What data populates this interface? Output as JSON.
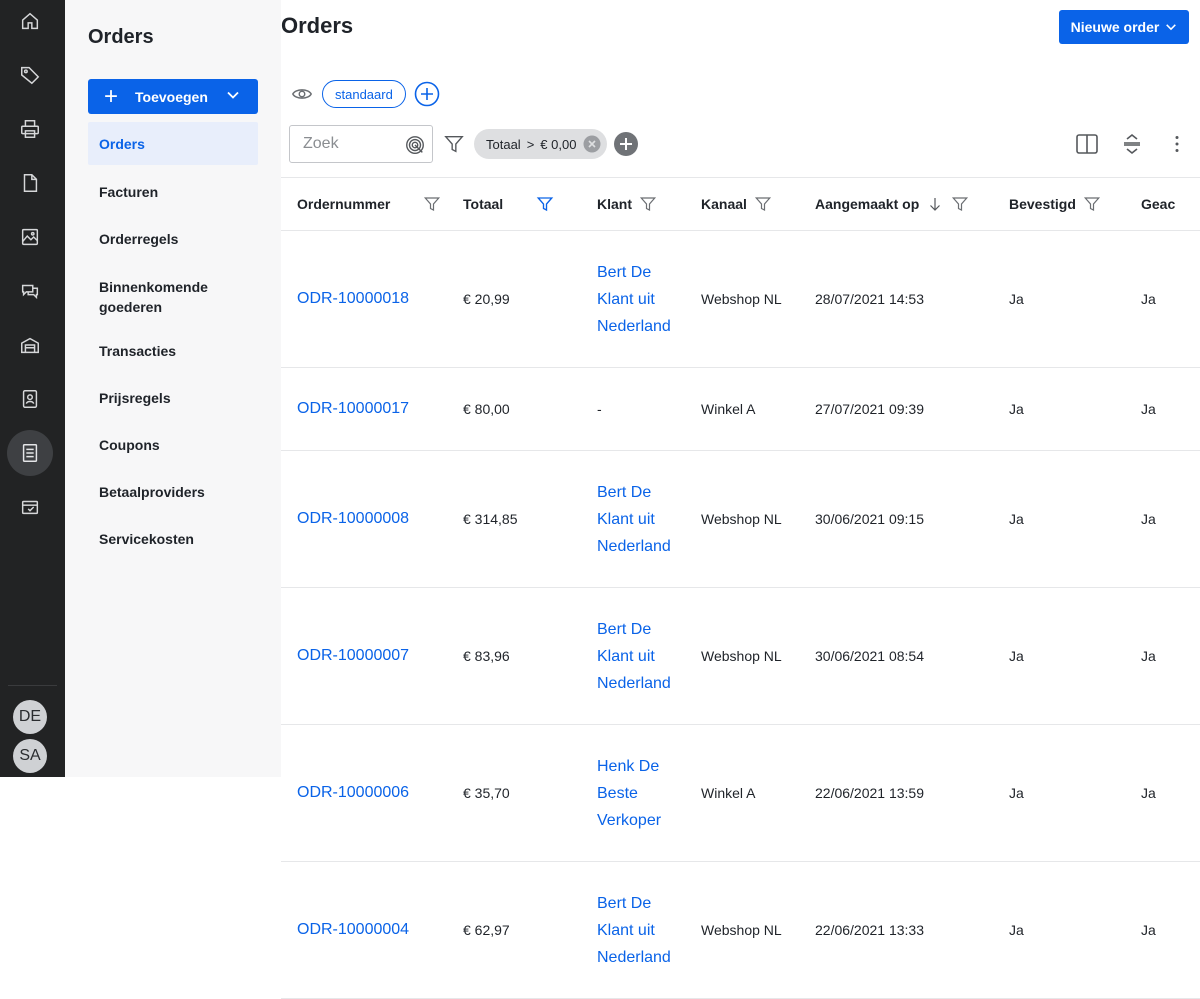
{
  "rail": {
    "icons": [
      "home-icon",
      "tag-icon",
      "printer-icon",
      "document-icon",
      "image-icon",
      "chat-icon",
      "warehouse-icon",
      "contact-book-icon",
      "order-list-icon",
      "package-check-icon"
    ],
    "active_icon": "order-list-icon",
    "avatars": [
      "DE",
      "SA"
    ]
  },
  "sidebar": {
    "title": "Orders",
    "add_label": "Toevoegen",
    "items": [
      "Orders",
      "Facturen",
      "Orderregels",
      "Binnenkomende goederen",
      "Transacties",
      "Prijsregels",
      "Coupons",
      "Betaalproviders",
      "Servicekosten"
    ],
    "active_item": "Orders"
  },
  "main": {
    "title": "Orders",
    "new_order_label": "Nieuwe order",
    "view_chip": "standaard",
    "search_placeholder": "Zoek",
    "filter_chip": {
      "field": "Totaal",
      "op": ">",
      "value": "€ 0,00"
    }
  },
  "table": {
    "columns": [
      "Ordernummer",
      "Totaal",
      "Klant",
      "Kanaal",
      "Aangemaakt op",
      "Bevestigd",
      "Geac"
    ],
    "rows": [
      {
        "order": "ODR-10000018",
        "totaal": "€ 20,99",
        "klant": [
          "Bert De",
          "Klant uit",
          "Nederland"
        ],
        "kanaal": "Webshop NL",
        "datum": "28/07/2021 14:53",
        "bevestigd": "Ja",
        "geac": "Ja"
      },
      {
        "order": "ODR-10000017",
        "totaal": "€ 80,00",
        "klant": [
          "-"
        ],
        "kanaal": "Winkel A",
        "datum": "27/07/2021 09:39",
        "bevestigd": "Ja",
        "geac": "Ja"
      },
      {
        "order": "ODR-10000008",
        "totaal": "€ 314,85",
        "klant": [
          "Bert De",
          "Klant uit",
          "Nederland"
        ],
        "kanaal": "Webshop NL",
        "datum": "30/06/2021 09:15",
        "bevestigd": "Ja",
        "geac": "Ja"
      },
      {
        "order": "ODR-10000007",
        "totaal": "€ 83,96",
        "klant": [
          "Bert De",
          "Klant uit",
          "Nederland"
        ],
        "kanaal": "Webshop NL",
        "datum": "30/06/2021 08:54",
        "bevestigd": "Ja",
        "geac": "Ja"
      },
      {
        "order": "ODR-10000006",
        "totaal": "€ 35,70",
        "klant": [
          "Henk De",
          "Beste",
          "Verkoper"
        ],
        "kanaal": "Winkel A",
        "datum": "22/06/2021 13:59",
        "bevestigd": "Ja",
        "geac": "Ja"
      },
      {
        "order": "ODR-10000004",
        "totaal": "€ 62,97",
        "klant": [
          "Bert De",
          "Klant uit",
          "Nederland"
        ],
        "kanaal": "Webshop NL",
        "datum": "22/06/2021 13:33",
        "bevestigd": "Ja",
        "geac": "Ja"
      }
    ]
  },
  "colors": {
    "accent": "#0a63e8",
    "rail": "#222324",
    "sidebar": "#f7f7f8"
  }
}
